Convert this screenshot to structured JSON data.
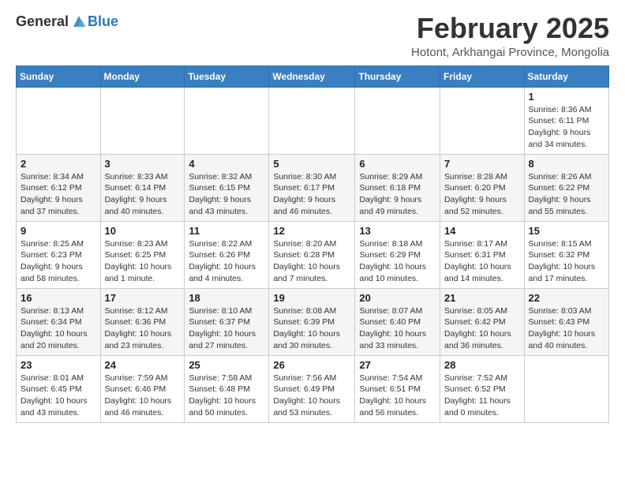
{
  "header": {
    "logo_general": "General",
    "logo_blue": "Blue",
    "main_title": "February 2025",
    "sub_title": "Hotont, Arkhangai Province, Mongolia"
  },
  "calendar": {
    "weekdays": [
      "Sunday",
      "Monday",
      "Tuesday",
      "Wednesday",
      "Thursday",
      "Friday",
      "Saturday"
    ],
    "weeks": [
      [
        {
          "day": "",
          "info": ""
        },
        {
          "day": "",
          "info": ""
        },
        {
          "day": "",
          "info": ""
        },
        {
          "day": "",
          "info": ""
        },
        {
          "day": "",
          "info": ""
        },
        {
          "day": "",
          "info": ""
        },
        {
          "day": "1",
          "info": "Sunrise: 8:36 AM\nSunset: 6:11 PM\nDaylight: 9 hours\nand 34 minutes."
        }
      ],
      [
        {
          "day": "2",
          "info": "Sunrise: 8:34 AM\nSunset: 6:12 PM\nDaylight: 9 hours\nand 37 minutes."
        },
        {
          "day": "3",
          "info": "Sunrise: 8:33 AM\nSunset: 6:14 PM\nDaylight: 9 hours\nand 40 minutes."
        },
        {
          "day": "4",
          "info": "Sunrise: 8:32 AM\nSunset: 6:15 PM\nDaylight: 9 hours\nand 43 minutes."
        },
        {
          "day": "5",
          "info": "Sunrise: 8:30 AM\nSunset: 6:17 PM\nDaylight: 9 hours\nand 46 minutes."
        },
        {
          "day": "6",
          "info": "Sunrise: 8:29 AM\nSunset: 6:18 PM\nDaylight: 9 hours\nand 49 minutes."
        },
        {
          "day": "7",
          "info": "Sunrise: 8:28 AM\nSunset: 6:20 PM\nDaylight: 9 hours\nand 52 minutes."
        },
        {
          "day": "8",
          "info": "Sunrise: 8:26 AM\nSunset: 6:22 PM\nDaylight: 9 hours\nand 55 minutes."
        }
      ],
      [
        {
          "day": "9",
          "info": "Sunrise: 8:25 AM\nSunset: 6:23 PM\nDaylight: 9 hours\nand 58 minutes."
        },
        {
          "day": "10",
          "info": "Sunrise: 8:23 AM\nSunset: 6:25 PM\nDaylight: 10 hours\nand 1 minute."
        },
        {
          "day": "11",
          "info": "Sunrise: 8:22 AM\nSunset: 6:26 PM\nDaylight: 10 hours\nand 4 minutes."
        },
        {
          "day": "12",
          "info": "Sunrise: 8:20 AM\nSunset: 6:28 PM\nDaylight: 10 hours\nand 7 minutes."
        },
        {
          "day": "13",
          "info": "Sunrise: 8:18 AM\nSunset: 6:29 PM\nDaylight: 10 hours\nand 10 minutes."
        },
        {
          "day": "14",
          "info": "Sunrise: 8:17 AM\nSunset: 6:31 PM\nDaylight: 10 hours\nand 14 minutes."
        },
        {
          "day": "15",
          "info": "Sunrise: 8:15 AM\nSunset: 6:32 PM\nDaylight: 10 hours\nand 17 minutes."
        }
      ],
      [
        {
          "day": "16",
          "info": "Sunrise: 8:13 AM\nSunset: 6:34 PM\nDaylight: 10 hours\nand 20 minutes."
        },
        {
          "day": "17",
          "info": "Sunrise: 8:12 AM\nSunset: 6:36 PM\nDaylight: 10 hours\nand 23 minutes."
        },
        {
          "day": "18",
          "info": "Sunrise: 8:10 AM\nSunset: 6:37 PM\nDaylight: 10 hours\nand 27 minutes."
        },
        {
          "day": "19",
          "info": "Sunrise: 8:08 AM\nSunset: 6:39 PM\nDaylight: 10 hours\nand 30 minutes."
        },
        {
          "day": "20",
          "info": "Sunrise: 8:07 AM\nSunset: 6:40 PM\nDaylight: 10 hours\nand 33 minutes."
        },
        {
          "day": "21",
          "info": "Sunrise: 8:05 AM\nSunset: 6:42 PM\nDaylight: 10 hours\nand 36 minutes."
        },
        {
          "day": "22",
          "info": "Sunrise: 8:03 AM\nSunset: 6:43 PM\nDaylight: 10 hours\nand 40 minutes."
        }
      ],
      [
        {
          "day": "23",
          "info": "Sunrise: 8:01 AM\nSunset: 6:45 PM\nDaylight: 10 hours\nand 43 minutes."
        },
        {
          "day": "24",
          "info": "Sunrise: 7:59 AM\nSunset: 6:46 PM\nDaylight: 10 hours\nand 46 minutes."
        },
        {
          "day": "25",
          "info": "Sunrise: 7:58 AM\nSunset: 6:48 PM\nDaylight: 10 hours\nand 50 minutes."
        },
        {
          "day": "26",
          "info": "Sunrise: 7:56 AM\nSunset: 6:49 PM\nDaylight: 10 hours\nand 53 minutes."
        },
        {
          "day": "27",
          "info": "Sunrise: 7:54 AM\nSunset: 6:51 PM\nDaylight: 10 hours\nand 56 minutes."
        },
        {
          "day": "28",
          "info": "Sunrise: 7:52 AM\nSunset: 6:52 PM\nDaylight: 11 hours\nand 0 minutes."
        },
        {
          "day": "",
          "info": ""
        }
      ]
    ]
  }
}
